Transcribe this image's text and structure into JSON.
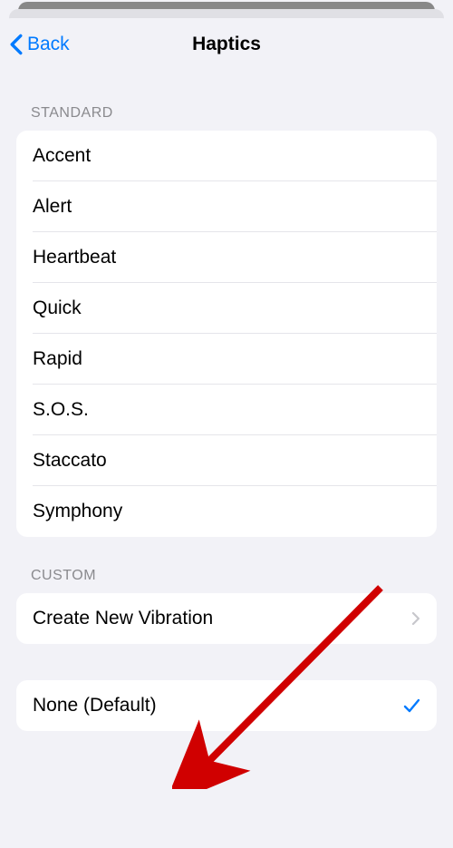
{
  "nav": {
    "back_label": "Back",
    "title": "Haptics"
  },
  "sections": {
    "standard_header": "STANDARD",
    "custom_header": "CUSTOM"
  },
  "standard_items": {
    "0": "Accent",
    "1": "Alert",
    "2": "Heartbeat",
    "3": "Quick",
    "4": "Rapid",
    "5": "S.O.S.",
    "6": "Staccato",
    "7": "Symphony"
  },
  "custom_items": {
    "create": "Create New Vibration"
  },
  "none_section": {
    "label": "None (Default)"
  }
}
